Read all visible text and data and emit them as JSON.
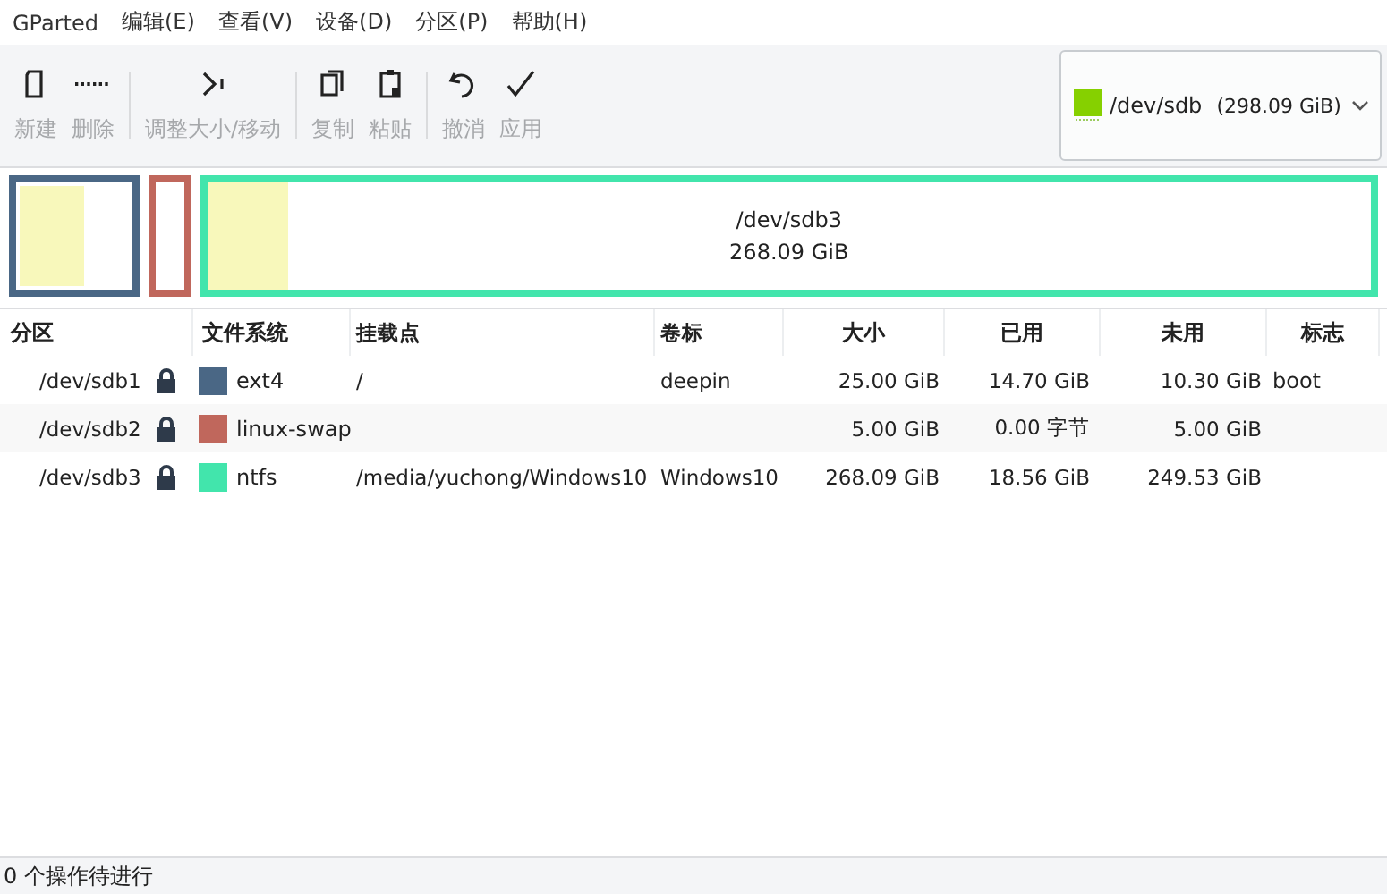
{
  "menu": [
    "GParted",
    "编辑(E)",
    "查看(V)",
    "设备(D)",
    "分区(P)",
    "帮助(H)"
  ],
  "toolbar": [
    {
      "kind": "new",
      "label": "新建",
      "disabled": true
    },
    {
      "kind": "delete",
      "label": "删除",
      "disabled": true
    },
    {
      "kind": "sep"
    },
    {
      "kind": "resize",
      "label": "调整大小/移动",
      "disabled": true
    },
    {
      "kind": "sep"
    },
    {
      "kind": "copy",
      "label": "复制",
      "disabled": true
    },
    {
      "kind": "paste",
      "label": "粘贴",
      "disabled": true
    },
    {
      "kind": "sep"
    },
    {
      "kind": "undo",
      "label": "撤消",
      "disabled": true
    },
    {
      "kind": "apply",
      "label": "应用",
      "disabled": true
    }
  ],
  "device": {
    "name": "/dev/sdb",
    "size": "(298.09 GiB)"
  },
  "map": [
    {
      "level": 0.59,
      "selected": false
    },
    {
      "selected": false
    },
    {
      "level": 0.07,
      "selected": true,
      "label": "/dev/sdb3",
      "size": "268.09 GiB"
    }
  ],
  "columns": [
    "分区",
    "文件系统",
    "挂载点",
    "卷标",
    "大小",
    "已用",
    "未用",
    "标志"
  ],
  "partitions": [
    {
      "name": "/dev/sdb1",
      "locked": true,
      "color": "#4a6785",
      "fs": "ext4",
      "mount": "/",
      "label": "deepin",
      "size": "25.00 GiB",
      "used": "14.70 GiB",
      "unused": "10.30 GiB",
      "flags": "boot"
    },
    {
      "name": "/dev/sdb2",
      "locked": true,
      "color": "#c0675c",
      "fs": "linux-swap",
      "size": "5.00 GiB",
      "used": "0.00 字节",
      "unused": "5.00 GiB"
    },
    {
      "name": "/dev/sdb3",
      "locked": true,
      "color": "#42e5ac",
      "fs": "ntfs",
      "mount": "/media/yuchong/Windows10",
      "label": "Windows10",
      "size": "268.09 GiB",
      "used": "18.56 GiB",
      "unused": "249.53 GiB"
    }
  ],
  "status_bar": "0 个操作待进行"
}
